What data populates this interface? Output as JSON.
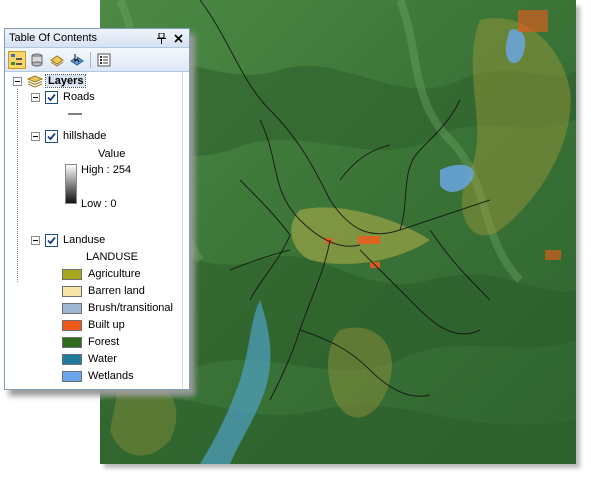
{
  "toc": {
    "title": "Table Of Contents",
    "pin_icon": "pin-icon",
    "close_icon": "close-icon",
    "toolbar": [
      "list-by-drawing-order-icon",
      "list-by-source-icon",
      "list-by-visibility-icon",
      "list-by-selection-icon",
      "options-icon"
    ],
    "data_frame": "Layers",
    "layers": {
      "roads": {
        "name": "Roads",
        "checked": true
      },
      "hillshade": {
        "name": "hillshade",
        "checked": true,
        "field": "Value",
        "high": "High : 254",
        "low": "Low : 0"
      },
      "landuse": {
        "name": "Landuse",
        "checked": true,
        "field": "LANDUSE",
        "classes": [
          {
            "label": "Agriculture",
            "color": "#a8a81e"
          },
          {
            "label": "Barren land",
            "color": "#f7e4a8"
          },
          {
            "label": "Brush/transitional",
            "color": "#9fb7d2"
          },
          {
            "label": "Built up",
            "color": "#ee5a1b"
          },
          {
            "label": "Forest",
            "color": "#2c6c1c"
          },
          {
            "label": "Water",
            "color": "#227a9a"
          },
          {
            "label": "Wetlands",
            "color": "#6da6ee"
          }
        ]
      }
    }
  }
}
